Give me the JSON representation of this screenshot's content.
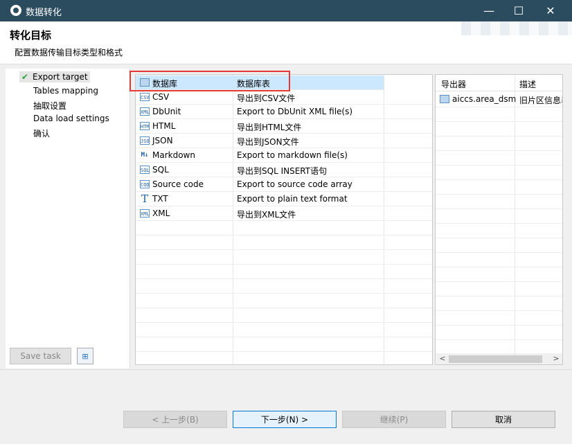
{
  "window": {
    "title": "数据转化",
    "minimize": "—",
    "maximize": "☐",
    "close": "✕"
  },
  "header": {
    "title": "转化目标",
    "subtitle": "配置数据传输目标类型和格式"
  },
  "nav": {
    "items": [
      {
        "label": "Export target",
        "active": true
      },
      {
        "label": "Tables mapping",
        "active": false
      },
      {
        "label": "抽取设置",
        "active": false
      },
      {
        "label": "Data load settings",
        "active": false
      },
      {
        "label": "确认",
        "active": false
      }
    ],
    "save_task_label": "Save task"
  },
  "exporters": [
    {
      "name": "数据库",
      "desc": "数据库表",
      "icon": "database-table-icon",
      "glyph": ""
    },
    {
      "name": "CSV",
      "desc": "导出到CSV文件",
      "icon": "csv-file-icon",
      "glyph": "CSV"
    },
    {
      "name": "DbUnit",
      "desc": "Export to DbUnit XML file(s)",
      "icon": "dbunit-file-icon",
      "glyph": "XML"
    },
    {
      "name": "HTML",
      "desc": "导出到HTML文件",
      "icon": "html-file-icon",
      "glyph": "HTML"
    },
    {
      "name": "JSON",
      "desc": "导出到JSON文件",
      "icon": "json-file-icon",
      "glyph": "JSON"
    },
    {
      "name": "Markdown",
      "desc": "Export to markdown file(s)",
      "icon": "markdown-icon",
      "glyph": "M↓"
    },
    {
      "name": "SQL",
      "desc": "导出到SQL INSERT语句",
      "icon": "sql-file-icon",
      "glyph": "SQL"
    },
    {
      "name": "Source code",
      "desc": "Export to source code array",
      "icon": "source-code-file-icon",
      "glyph": "CODE"
    },
    {
      "name": "TXT",
      "desc": "Export to plain text format",
      "icon": "text-format-icon",
      "glyph": "T"
    },
    {
      "name": "XML",
      "desc": "导出到XML文件",
      "icon": "xml-file-icon",
      "glyph": "XML"
    }
  ],
  "right_table": {
    "headers": [
      "导出器",
      "描述"
    ],
    "rows": [
      {
        "exporter": "aiccs.area_dsm",
        "desc": "旧片区信息表"
      }
    ]
  },
  "footer": {
    "back": "< 上一步(B)",
    "next": "下一步(N) >",
    "continue": "继续(P)",
    "cancel": "取消"
  }
}
